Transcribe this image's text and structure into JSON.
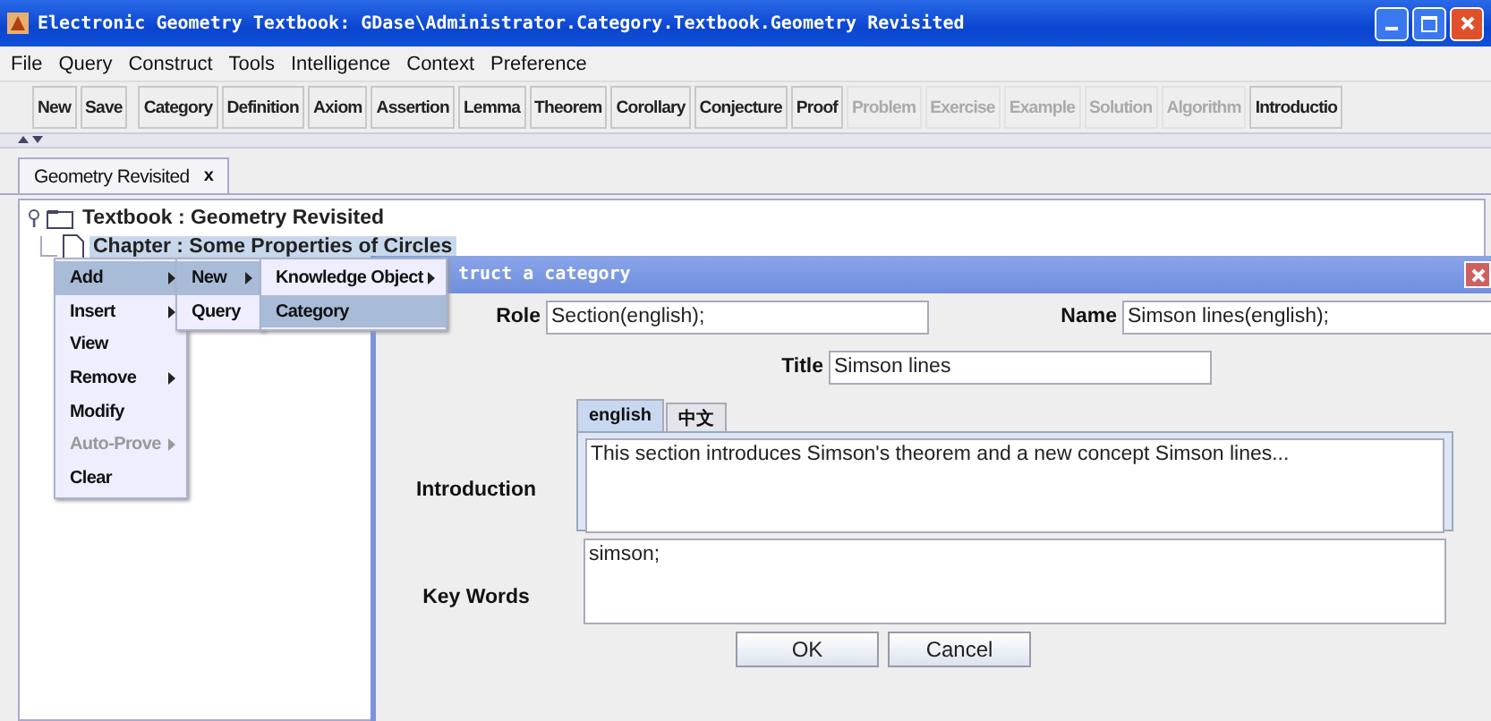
{
  "window": {
    "title": "Electronic Geometry Textbook: GDase\\Administrator.Category.Textbook.Geometry Revisited"
  },
  "menu_bar": [
    "File",
    "Query",
    "Construct",
    "Tools",
    "Intelligence",
    "Context",
    "Preference"
  ],
  "toolbar": {
    "groups": [
      {
        "buttons": [
          {
            "label": "New",
            "disabled": false
          },
          {
            "label": "Save",
            "disabled": false
          }
        ]
      },
      {
        "buttons": [
          {
            "label": "Category",
            "disabled": false
          },
          {
            "label": "Definition",
            "disabled": false
          },
          {
            "label": "Axiom",
            "disabled": false
          },
          {
            "label": "Assertion",
            "disabled": false
          },
          {
            "label": "Lemma",
            "disabled": false
          },
          {
            "label": "Theorem",
            "disabled": false
          },
          {
            "label": "Corollary",
            "disabled": false
          },
          {
            "label": "Conjecture",
            "disabled": false
          },
          {
            "label": "Proof",
            "disabled": false
          },
          {
            "label": "Problem",
            "disabled": true
          },
          {
            "label": "Exercise",
            "disabled": true
          },
          {
            "label": "Example",
            "disabled": true
          },
          {
            "label": "Solution",
            "disabled": true
          },
          {
            "label": "Algorithm",
            "disabled": true
          },
          {
            "label": "Introductio",
            "disabled": false
          }
        ]
      }
    ]
  },
  "doc_tabs": [
    {
      "label": "Geometry Revisited",
      "selected": true,
      "close": "x"
    }
  ],
  "tree": {
    "label": "Textbook : Geometry Revisited",
    "expanded": true,
    "selected": false,
    "children": [
      {
        "label": "Chapter : Some Properties of Circles",
        "selected": true
      }
    ]
  },
  "context_menu": {
    "items": [
      {
        "label": "Add",
        "submenu": true,
        "disabled": false,
        "selected": true
      },
      {
        "label": "Insert",
        "submenu": true,
        "disabled": false,
        "selected": false
      },
      {
        "label": "View",
        "submenu": false,
        "disabled": false,
        "selected": false
      },
      {
        "label": "Remove",
        "submenu": true,
        "disabled": false,
        "selected": false
      },
      {
        "label": "Modify",
        "submenu": false,
        "disabled": false,
        "selected": false
      },
      {
        "label": "Auto-Prove",
        "submenu": true,
        "disabled": true,
        "selected": false
      },
      {
        "label": "Clear",
        "submenu": false,
        "disabled": false,
        "selected": false
      }
    ]
  },
  "add_submenu": {
    "items": [
      {
        "label": "New",
        "submenu": true,
        "disabled": false,
        "selected": true
      },
      {
        "label": "Query",
        "submenu": false,
        "disabled": false,
        "selected": false
      }
    ]
  },
  "new_submenu": {
    "items": [
      {
        "label": "Knowledge Object",
        "submenu": true,
        "disabled": false,
        "selected": false
      },
      {
        "label": "Category",
        "submenu": false,
        "disabled": false,
        "selected": true
      }
    ]
  },
  "dialog": {
    "title": "truct a category",
    "role": {
      "label": "Role",
      "value": "Section(english);"
    },
    "name": {
      "label": "Name",
      "value": "Simson lines(english);"
    },
    "title_field": {
      "label": "Title",
      "value": "Simson lines"
    },
    "lang_tabs": [
      {
        "label": "english",
        "selected": true
      },
      {
        "label": "中文",
        "selected": false
      }
    ],
    "introduction": {
      "label": "Introduction",
      "value": "This section introduces Simson's theorem and a new concept Simson lines..."
    },
    "key_words": {
      "label": "Key Words",
      "value": "simson;"
    },
    "buttons": [
      "OK",
      "Cancel"
    ]
  }
}
